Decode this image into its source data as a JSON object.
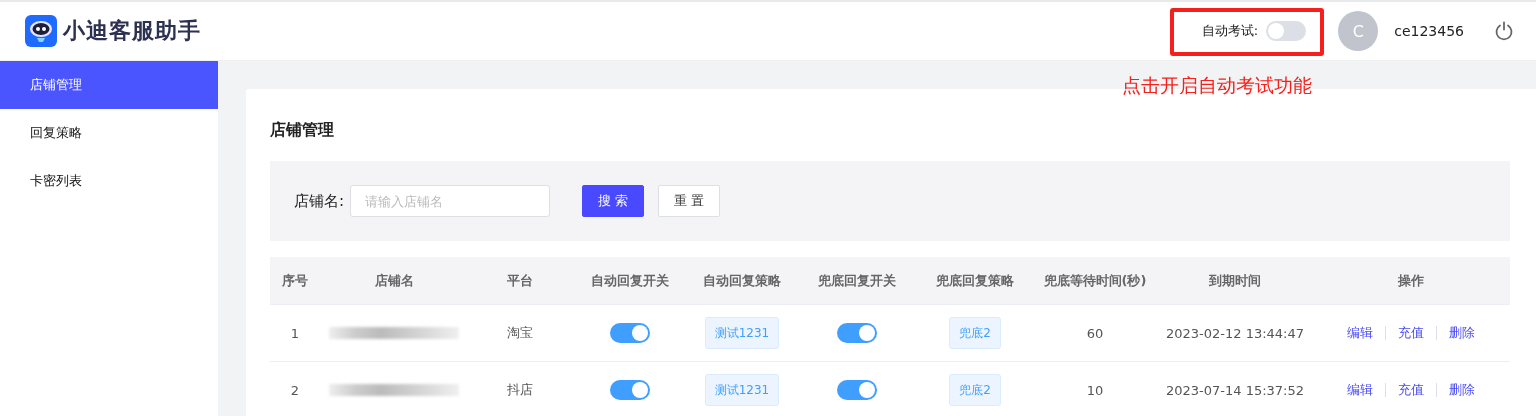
{
  "header": {
    "app_name": "小迪客服助手",
    "auto_exam": {
      "label": "自动考试:",
      "on": false
    },
    "avatar_letter": "C",
    "username": "ce123456"
  },
  "annotation": {
    "text": "点击开启自动考试功能"
  },
  "sidebar": {
    "items": [
      {
        "label": "店铺管理",
        "selected": true
      },
      {
        "label": "回复策略",
        "selected": false
      },
      {
        "label": "卡密列表",
        "selected": false
      }
    ]
  },
  "page": {
    "title": "店铺管理",
    "filter": {
      "label": "店铺名:",
      "placeholder": "请输入店铺名",
      "buttons": [
        {
          "label": "搜 索",
          "kind": "primary"
        },
        {
          "label": "重 置",
          "kind": "default"
        }
      ]
    }
  },
  "table": {
    "columns": [
      "序号",
      "店铺名",
      "平台",
      "自动回复开关",
      "自动回复策略",
      "兜底回复开关",
      "兜底回复策略",
      "兜底等待时间(秒)",
      "到期时间",
      "操作"
    ],
    "rows": [
      {
        "index": "1",
        "name_redacted": true,
        "platform": "淘宝",
        "auto_reply_on": true,
        "auto_strategy": "测试1231",
        "fallback_on": true,
        "fallback_strategy": "兜底2",
        "wait": "60",
        "expires": "2023-02-12 13:44:47",
        "actions": [
          "编辑",
          "充值",
          "删除"
        ]
      },
      {
        "index": "2",
        "name_redacted": true,
        "platform": "抖店",
        "auto_reply_on": true,
        "auto_strategy": "测试1231",
        "fallback_on": true,
        "fallback_strategy": "兜底2",
        "wait": "10",
        "expires": "2023-07-14 15:37:52",
        "actions": [
          "编辑",
          "充值",
          "删除"
        ]
      }
    ]
  }
}
